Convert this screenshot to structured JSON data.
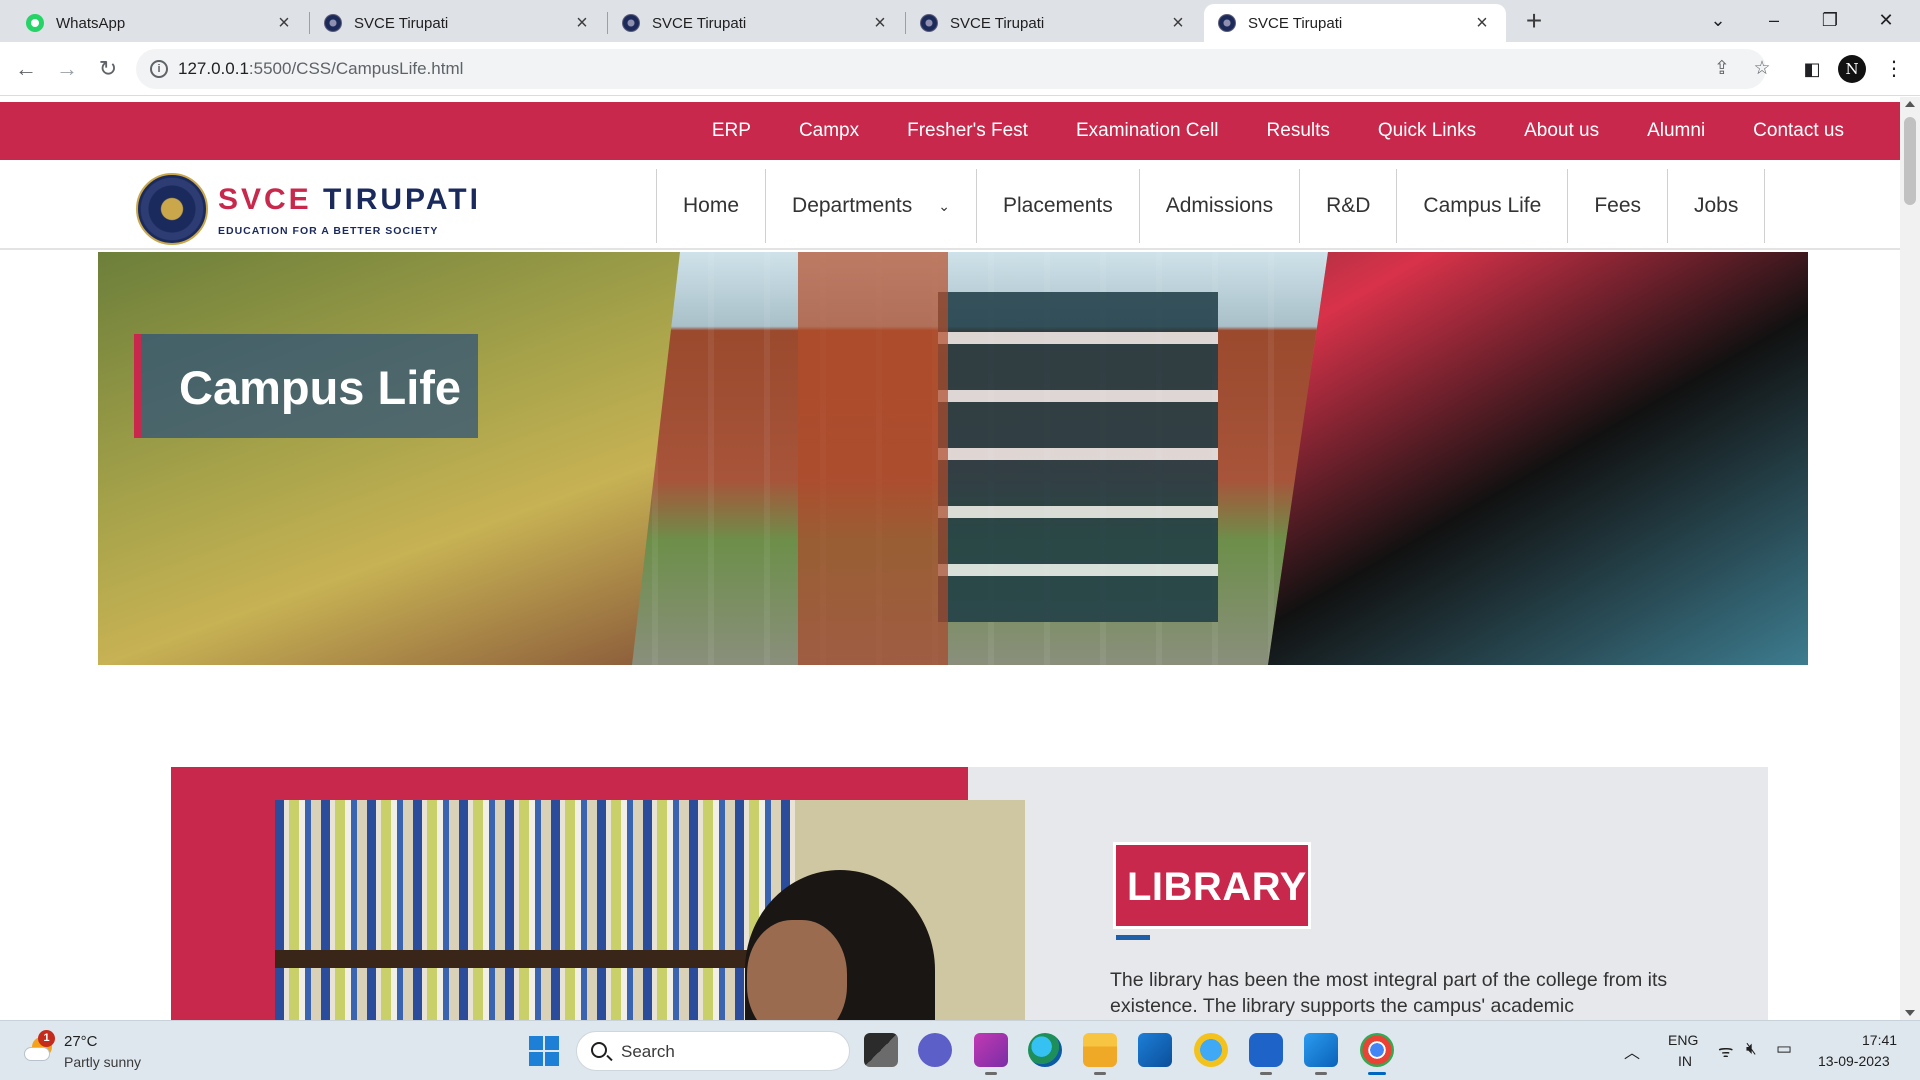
{
  "browser": {
    "tabs": [
      {
        "title": "WhatsApp",
        "favicon": "whatsapp-icon",
        "active": false
      },
      {
        "title": "SVCE Tirupati",
        "favicon": "svce-favicon",
        "active": false
      },
      {
        "title": "SVCE Tirupati",
        "favicon": "svce-favicon",
        "active": false
      },
      {
        "title": "SVCE Tirupati",
        "favicon": "svce-favicon",
        "active": false
      },
      {
        "title": "SVCE Tirupati",
        "favicon": "svce-favicon",
        "active": true
      }
    ],
    "close_glyph": "×",
    "new_tab_glyph": "+",
    "url_host": "127.0.0.1",
    "url_rest": ":5500/CSS/CampusLife.html",
    "profile_initial": "N"
  },
  "site": {
    "top_links": [
      "ERP",
      "Campx",
      "Fresher's Fest",
      "Examination Cell",
      "Results",
      "Quick Links",
      "About us",
      "Alumni",
      "Contact us"
    ],
    "logo_name_primary": "SVCE",
    "logo_name_secondary": "TIRUPATI",
    "logo_tagline": "EDUCATION FOR A BETTER SOCIETY",
    "main_nav": [
      "Home",
      "Departments",
      "Placements",
      "Admissions",
      "R&D",
      "Campus Life",
      "Fees",
      "Jobs"
    ],
    "hero_title": "Campus Life",
    "section_title": "LIBRARY",
    "section_text": "The library has been the most integral part of the college from its existence. The library supports the campus' academic",
    "brand_color": "#c8284c",
    "navy_color": "#1b2a5c"
  },
  "taskbar": {
    "weather_temp": "27°C",
    "weather_desc": "Partly sunny",
    "weather_badge": "1",
    "search_placeholder": "Search",
    "lang_line1": "ENG",
    "lang_line2": "IN",
    "time": "17:41",
    "date": "13-09-2023"
  }
}
